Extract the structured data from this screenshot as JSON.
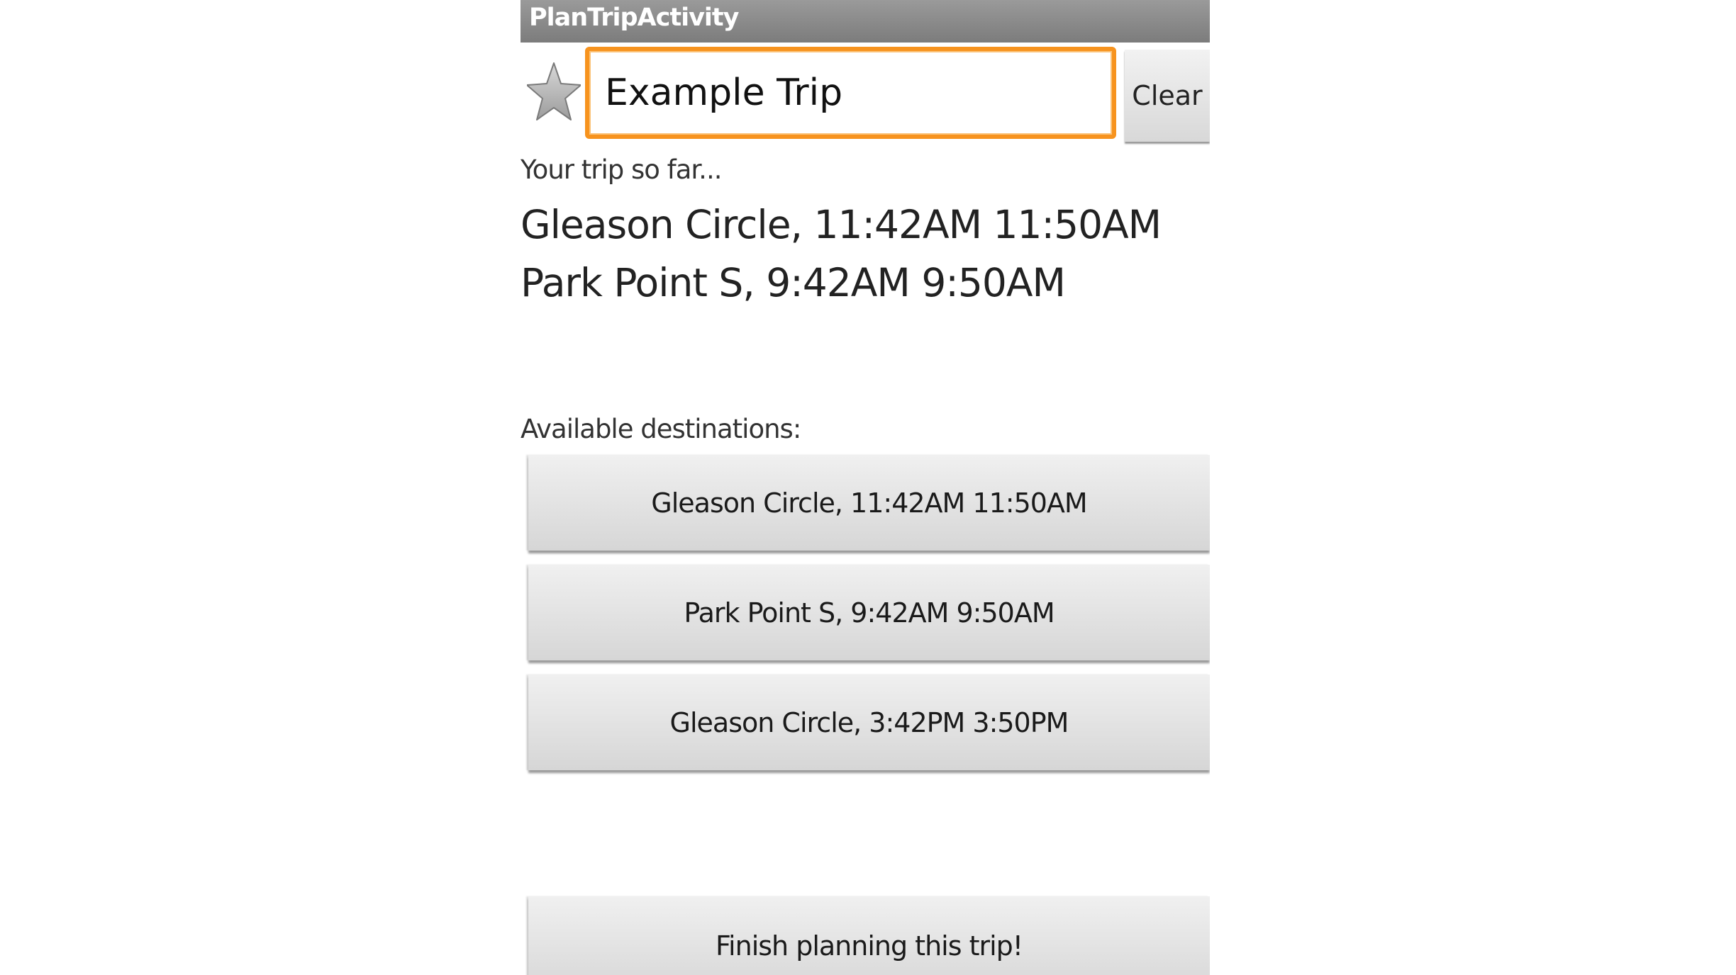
{
  "app": {
    "title": "PlanTripActivity"
  },
  "trip_name": {
    "value": "Example Trip",
    "placeholder": ""
  },
  "favorite_icon": "star-icon",
  "clear_label": "Clear",
  "trip": {
    "heading": "Your trip so far...",
    "stops": [
      "Gleason Circle, 11:42AM 11:50AM",
      "Park Point S, 9:42AM 9:50AM"
    ]
  },
  "destinations": {
    "heading": "Available destinations:",
    "items": [
      "Gleason Circle, 11:42AM 11:50AM",
      "Park Point S, 9:42AM 9:50AM",
      "Gleason Circle, 3:42PM 3:50PM"
    ]
  },
  "finish_label": "Finish planning this trip!",
  "colors": {
    "title_bar": "#8a8a8a",
    "input_focus": "#f7931e",
    "button_bg": "#e4e4e4"
  }
}
